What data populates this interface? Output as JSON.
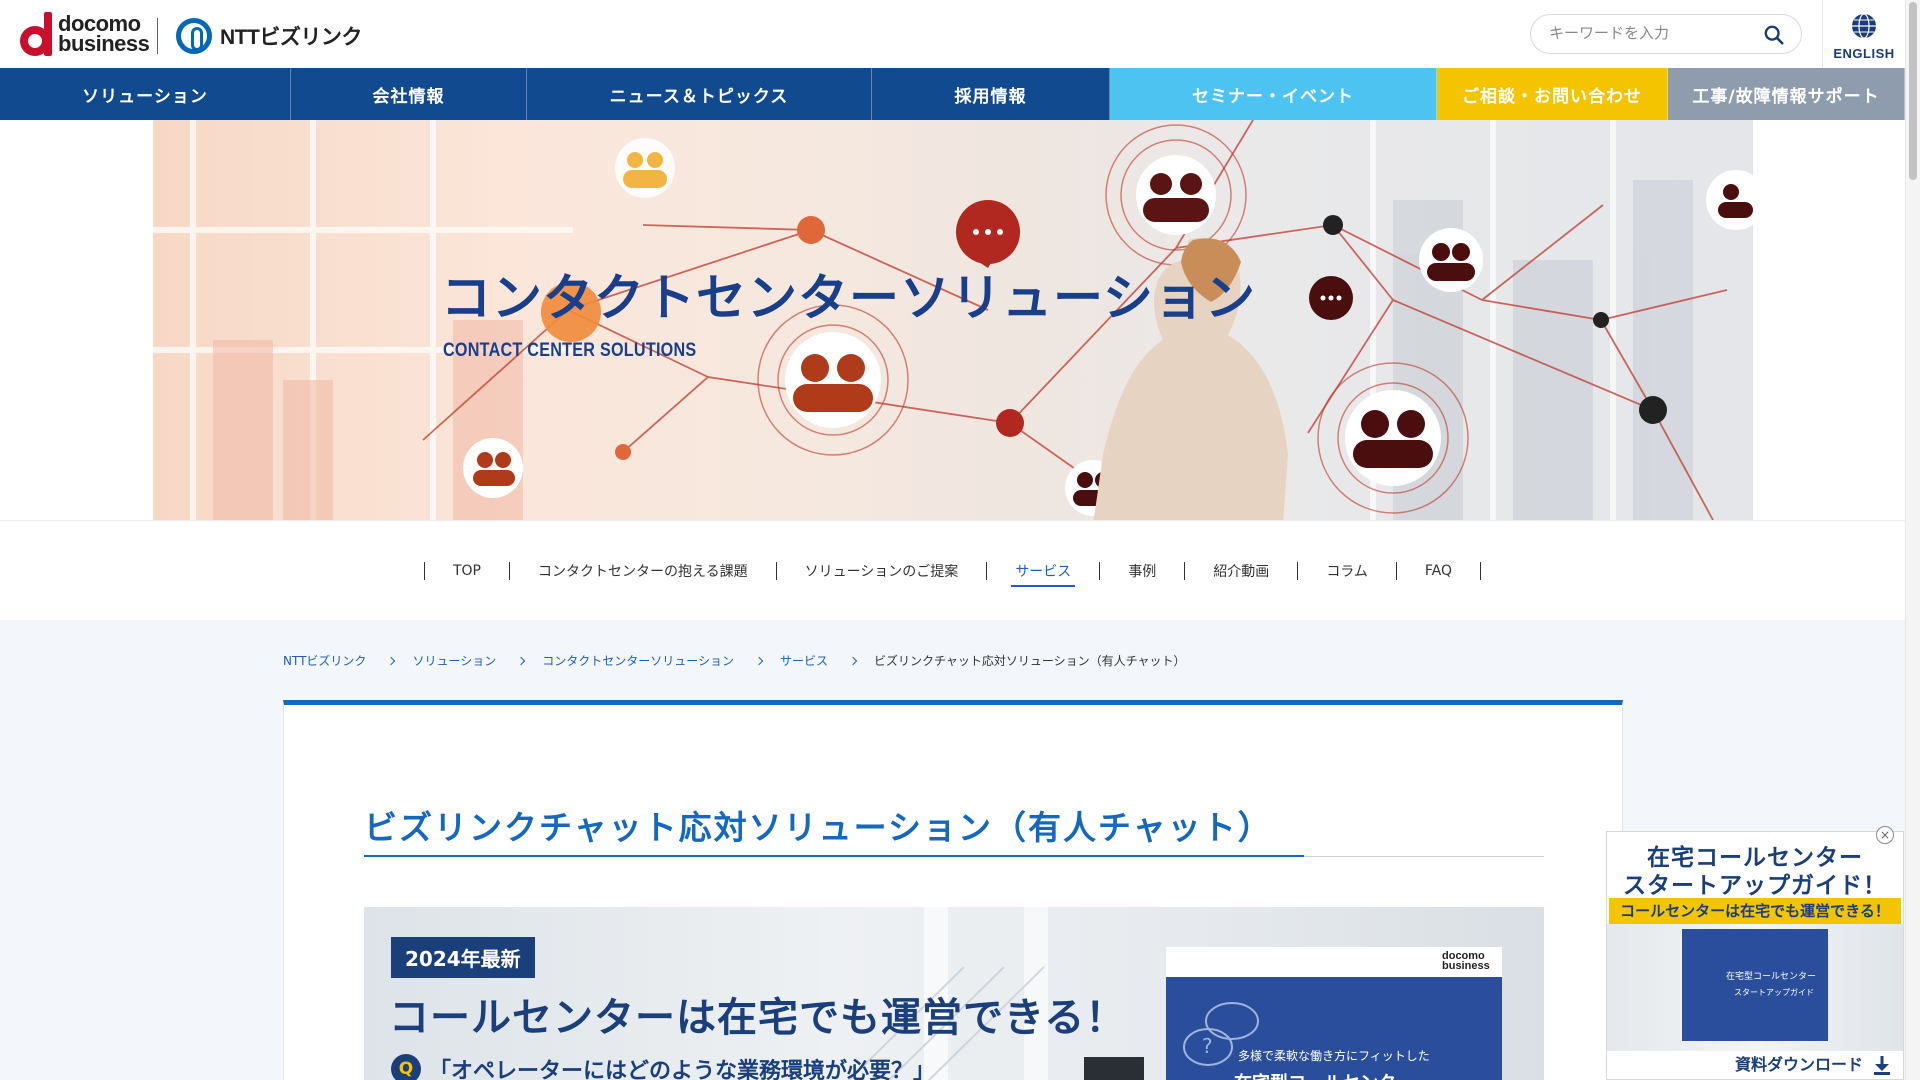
{
  "header": {
    "docomo_logo_line1": "docomo",
    "docomo_logo_line2": "business",
    "ntt_logo_text": "NTTビズリンク",
    "search_placeholder": "キーワードを入力",
    "english_label": "ENGLISH"
  },
  "global_nav": [
    {
      "label": "ソリューション",
      "color": "#114a8f"
    },
    {
      "label": "会社情報",
      "color": "#114a8f"
    },
    {
      "label": "ニュース＆トピックス",
      "color": "#114a8f"
    },
    {
      "label": "採用情報",
      "color": "#114a8f"
    },
    {
      "label": "セミナー・イベント",
      "color": "#4cc3f0"
    },
    {
      "label": "ご相談・お問い合わせ",
      "color": "#f4c400"
    },
    {
      "label": "工事/故障情報サポート",
      "color": "#8e9cae"
    }
  ],
  "hero": {
    "title": "コンタクトセンターソリューション",
    "subtitle": "CONTACT CENTER SOLUTIONS"
  },
  "local_nav": {
    "items": [
      "TOP",
      "コンタクトセンターの抱える課題",
      "ソリューションのご提案",
      "サービス",
      "事例",
      "紹介動画",
      "コラム",
      "FAQ"
    ],
    "active": "サービス"
  },
  "breadcrumb": {
    "links": [
      "NTTビズリンク",
      "ソリューション",
      "コンタクトセンターソリューション",
      "サービス"
    ],
    "current": "ビズリンクチャット応対ソリューション（有人チャット）"
  },
  "page": {
    "title": "ビズリンクチャット応対ソリューション（有人チャット）"
  },
  "banner": {
    "badge": "2024年最新",
    "heading": "コールセンターは在宅でも運営できる！",
    "question_mark": "Q",
    "question": "「オペレーターにはどのような業務環境が必要？」",
    "book_logo_line1": "docomo",
    "book_logo_line2": "business",
    "book_text": "多様で柔軟な働き方にフィットした",
    "book_text2": "在宅型コールセンター"
  },
  "float_ad": {
    "title_line1": "在宅コールセンター",
    "title_line2": "スタートアップガイド！",
    "strip": "コールセンターは在宅でも運営できる！",
    "book_line1": "在宅型コールセンター",
    "book_line2": "スタートアップガイド",
    "download": "資料ダウンロード",
    "close_symbol": "×"
  },
  "colors": {
    "brand_blue": "#114a8f",
    "accent_blue": "#1468c2",
    "sky": "#4cc3f0",
    "yellow": "#f4c400",
    "gray": "#8e9cae",
    "docomo_red": "#c8102e"
  }
}
